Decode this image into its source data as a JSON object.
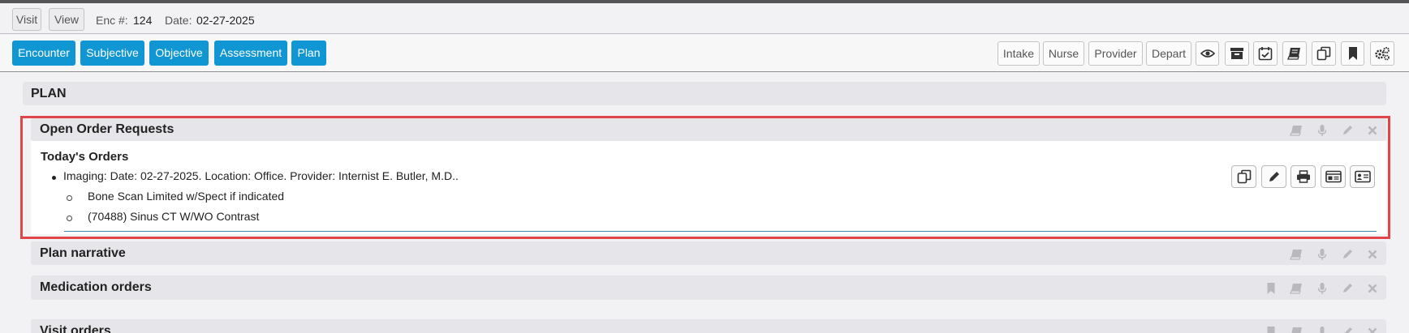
{
  "toolbar": {
    "visit_label": "Visit",
    "view_label": "View",
    "enc_label": "Enc #:",
    "enc_value": "124",
    "date_label": "Date:",
    "date_value": "02-27-2025"
  },
  "tabs": [
    {
      "label": "Encounter"
    },
    {
      "label": "Subjective"
    },
    {
      "label": "Objective"
    },
    {
      "label": "Assessment"
    },
    {
      "label": "Plan"
    }
  ],
  "right_tools": {
    "labels": [
      "Intake",
      "Nurse",
      "Provider",
      "Depart"
    ],
    "icons": [
      "eye-icon",
      "archive-icon",
      "calendar-check-icon",
      "book-icon",
      "copy-icon",
      "bookmark-icon",
      "gears-icon"
    ]
  },
  "page": {
    "title": "PLAN"
  },
  "sections": {
    "open_orders": {
      "title": "Open Order Requests",
      "subheading": "Today's Orders",
      "order_line": "Imaging: Date: 02-27-2025. Location: Office. Provider: Internist E. Butler, M.D..",
      "items": [
        "Bone Scan Limited w/Spect if indicated",
        "(70488) Sinus CT W/WO Contrast"
      ],
      "action_icons": [
        "copy-icon",
        "pencil-icon",
        "print-icon",
        "id-card-icon",
        "contact-card-icon"
      ],
      "header_icons": [
        "book-icon",
        "microphone-icon",
        "pencil-icon",
        "close-icon"
      ]
    },
    "plan_narrative": {
      "title": "Plan narrative"
    },
    "medication_orders": {
      "title": "Medication orders"
    },
    "visit_orders": {
      "title": "Visit orders"
    }
  },
  "colors": {
    "tab_blue": "#1196d4",
    "highlight_red": "#e0454a",
    "section_gray": "#e6e6ea",
    "teal_rule": "#3d8fa8"
  }
}
